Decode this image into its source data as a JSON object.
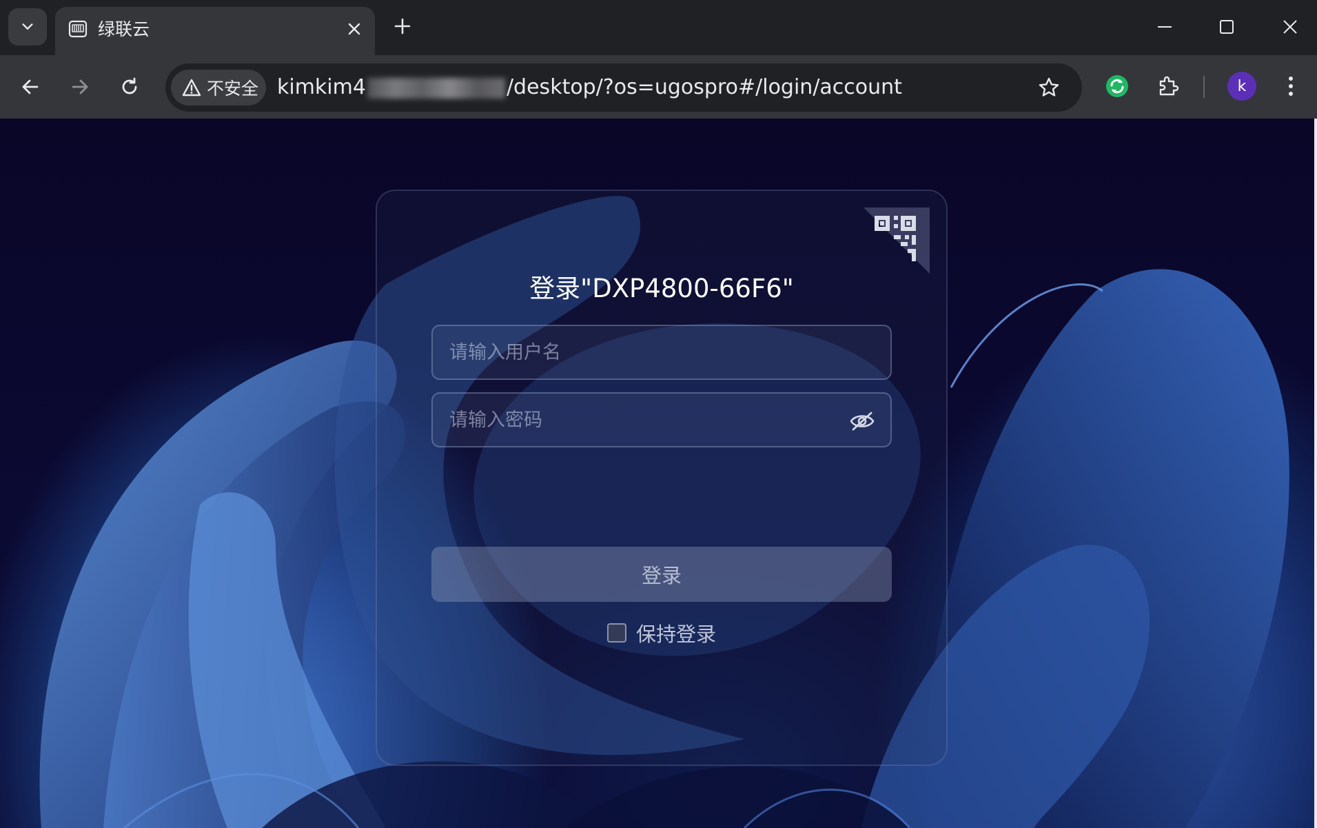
{
  "browser": {
    "tab": {
      "title": "绿联云"
    },
    "toolbar": {
      "security_label": "不安全",
      "url_prefix": "kimkim4",
      "url_suffix": "/desktop/?os=ugospro#/login/account"
    },
    "profile": {
      "initial": "k"
    },
    "icons": {
      "tab_search": "chevron-down-icon",
      "favicon": "nas-favicon",
      "close": "close-icon",
      "new_tab": "plus-icon",
      "minimize": "minimize-icon",
      "maximize": "maximize-icon",
      "window_close": "window-close-icon",
      "back": "back-arrow-icon",
      "forward": "forward-arrow-icon",
      "reload": "reload-icon",
      "warning": "warning-triangle-icon",
      "bookmark": "star-icon",
      "sync_extension": "sync-extension-icon",
      "extensions": "puzzle-icon",
      "menu": "kebab-menu-icon"
    }
  },
  "login": {
    "title": "登录\"DXP4800-66F6\"",
    "username_placeholder": "请输入用户名",
    "password_placeholder": "请输入密码",
    "submit_label": "登录",
    "remember_label": "保持登录",
    "remember_checked": false,
    "icons": {
      "qr": "qr-code-icon",
      "password_toggle": "eye-off-icon"
    }
  },
  "colors": {
    "chrome_dark": "#202124",
    "chrome_toolbar": "#35363a",
    "page_background": "#0a0724",
    "wallpaper_blue": "#3f6fbf",
    "avatar": "#5b2fb8",
    "sync_extension_green": "#1fb865"
  }
}
